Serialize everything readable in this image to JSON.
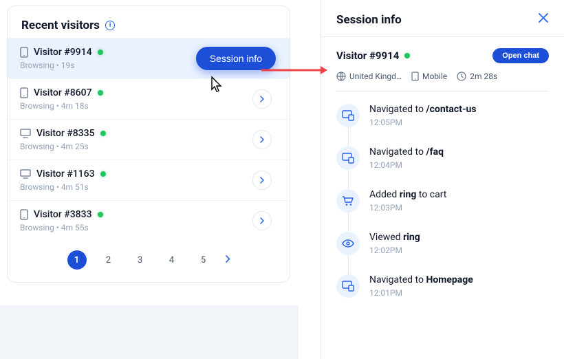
{
  "recent_visitors": {
    "title": "Recent visitors",
    "items": [
      {
        "name": "Visitor #9914",
        "device": "mobile",
        "status": "Browsing",
        "duration": "19s",
        "selected": true
      },
      {
        "name": "Visitor #8607",
        "device": "mobile",
        "status": "Browsing",
        "duration": "4m 18s"
      },
      {
        "name": "Visitor #8335",
        "device": "desktop",
        "status": "Browsing",
        "duration": "4m 25s"
      },
      {
        "name": "Visitor #1163",
        "device": "desktop",
        "status": "Browsing",
        "duration": "4m 51s"
      },
      {
        "name": "Visitor #3833",
        "device": "mobile",
        "status": "Browsing",
        "duration": "4m 55s"
      }
    ],
    "session_info_btn": "Session info",
    "pages": [
      "1",
      "2",
      "3",
      "4",
      "5"
    ]
  },
  "session": {
    "title": "Session info",
    "visitor_name": "Visitor #9914",
    "open_chat_btn": "Open chat",
    "meta": {
      "country": "United Kingd…",
      "device": "Mobile",
      "duration": "2m 28s"
    },
    "events": [
      {
        "icon": "nav",
        "prefix": "Navigated to ",
        "bold": "/contact-us",
        "suffix": "",
        "time": "12:05PM"
      },
      {
        "icon": "nav",
        "prefix": "Navigated to ",
        "bold": "/faq",
        "suffix": "",
        "time": "12:04PM"
      },
      {
        "icon": "cart",
        "prefix": "Added ",
        "bold": "ring",
        "suffix": " to cart",
        "time": "12:03PM"
      },
      {
        "icon": "eye",
        "prefix": "Viewed ",
        "bold": "ring",
        "suffix": "",
        "time": "12:02PM"
      },
      {
        "icon": "nav",
        "prefix": "Navigated to ",
        "bold": "Homepage",
        "suffix": "",
        "time": "12:01PM"
      }
    ]
  }
}
